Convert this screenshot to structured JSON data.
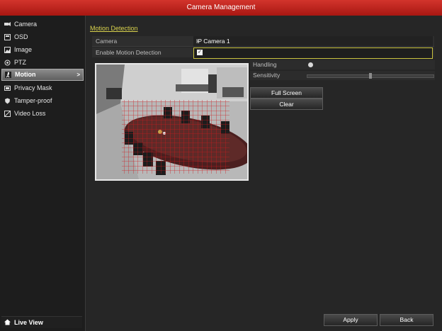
{
  "window": {
    "title": "Camera Management"
  },
  "sidebar": {
    "items": [
      {
        "label": "Camera",
        "icon": "camera-icon"
      },
      {
        "label": "OSD",
        "icon": "osd-icon"
      },
      {
        "label": "Image",
        "icon": "image-icon"
      },
      {
        "label": "PTZ",
        "icon": "ptz-icon"
      },
      {
        "label": "Motion",
        "icon": "motion-icon",
        "active": true
      },
      {
        "label": "Privacy Mask",
        "icon": "privacy-mask-icon"
      },
      {
        "label": "Tamper-proof",
        "icon": "tamper-proof-icon"
      },
      {
        "label": "Video Loss",
        "icon": "video-loss-icon"
      }
    ],
    "active_arrow": ">",
    "live_view_label": "Live View"
  },
  "main": {
    "section_title": "Motion Detection",
    "camera_label": "Camera",
    "camera_value": "IP Camera 1",
    "camera_dropdown_symbol": "⌄",
    "enable_label": "Enable Motion Detection",
    "enable_checked": true,
    "enable_check_symbol": "✓",
    "handling_label": "Handling",
    "sensitivity_label": "Sensitivity",
    "sensitivity_level": 0.5,
    "full_screen_label": "Full Screen",
    "clear_label": "Clear",
    "apply_label": "Apply",
    "back_label": "Back"
  },
  "colors": {
    "title_bar": "#c0231b",
    "section_title": "#d9d24d",
    "motion_grid": "#d0171c",
    "enable_border": "#c9c23f"
  }
}
